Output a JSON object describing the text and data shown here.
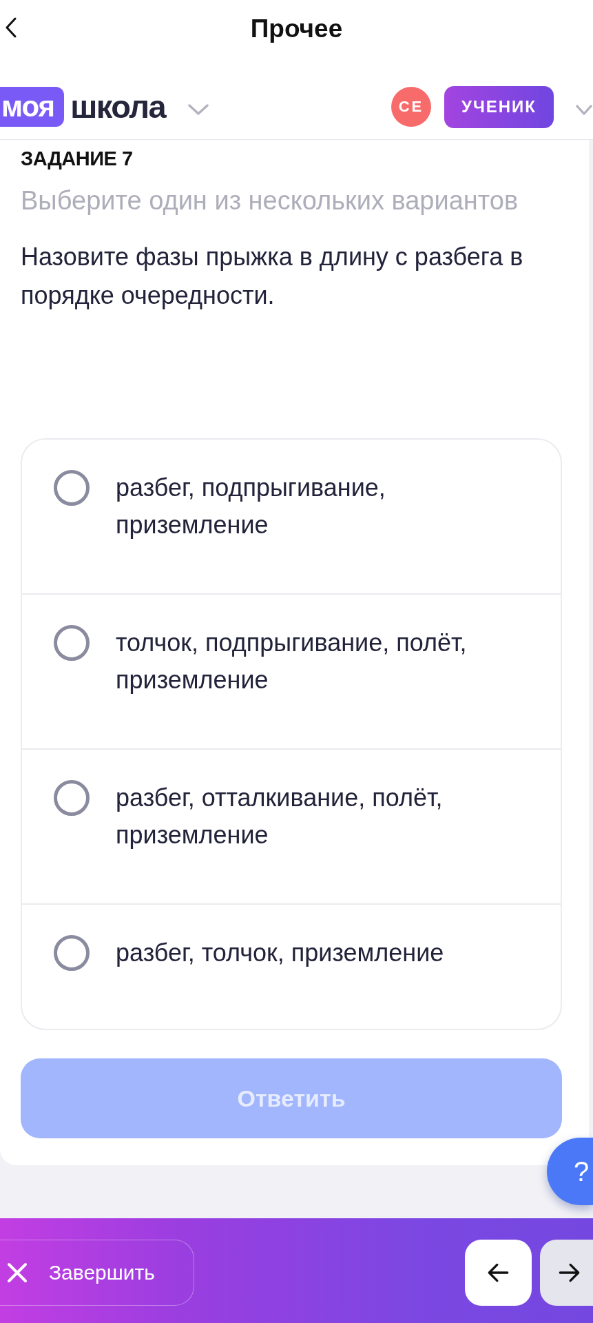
{
  "nav_bar": {
    "title": "Прочее"
  },
  "header": {
    "logo": {
      "badge": "моя",
      "text": "школа"
    },
    "avatar": {
      "initials": "СЕ"
    },
    "role_badge": "УЧЕНИК"
  },
  "task": {
    "number_label": "ЗАДАНИЕ 7",
    "instruction": "Выберите один из нескольких вариантов",
    "question": "Назовите фазы прыжка в длину с разбега в порядке очередности.",
    "options": [
      {
        "text": "разбег, подпрыгивание, приземление",
        "selected": false
      },
      {
        "text": "толчок, подпрыгивание, полёт, приземление",
        "selected": false
      },
      {
        "text": "разбег, отталкивание, полёт, приземление",
        "selected": false
      },
      {
        "text": "разбег, толчок, приземление",
        "selected": false
      }
    ],
    "answer_button": {
      "label": "Ответить",
      "disabled": true
    }
  },
  "help_button": {
    "label": "?"
  },
  "bottom_bar": {
    "finish_button": {
      "label": "Завершить"
    },
    "nav_buttons": [
      {
        "kind": "back",
        "disabled": false
      },
      {
        "kind": "forward",
        "disabled": true
      }
    ]
  }
}
